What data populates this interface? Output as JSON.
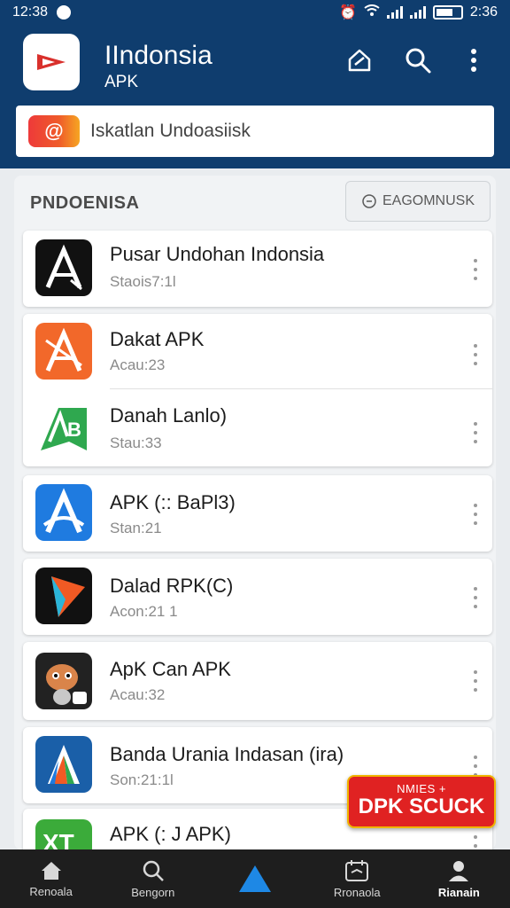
{
  "status_bar": {
    "time": "12:38",
    "clock": "2:36"
  },
  "header": {
    "title": "IIndonsia",
    "subtitle": "APK"
  },
  "search": {
    "placeholder": "Iskatlan Undoasiisk",
    "logo_text": "@"
  },
  "section": {
    "title": "PNDOENISA",
    "button_label": "EAGOMNUSK"
  },
  "apps": [
    {
      "name": "Pusar Undohan Indonsia",
      "meta": "Staois7:1l",
      "icon": "a-letter-black-icon"
    },
    {
      "name": "Dakat APK",
      "meta": "Acau:23",
      "icon": "a-letter-orange-icon"
    },
    {
      "name": "Danah Lanlo)",
      "meta": "Stau:33",
      "icon": "ab-green-icon"
    },
    {
      "name": "APK (:: BaPl3)",
      "meta": "Stan:21",
      "icon": "a-letter-blue-icon"
    },
    {
      "name": "Dalad RPK(C)",
      "meta": "Acon:21 1",
      "icon": "play-triangle-icon"
    },
    {
      "name": "ApK Can APK",
      "meta": "Acau:32",
      "icon": "creature-mascot-icon"
    },
    {
      "name": "Banda Urania Indasan (ira)",
      "meta": "Son:21:1l",
      "icon": "triangle-stripes-icon"
    },
    {
      "name": "APK (: J APK)",
      "meta": "",
      "icon": "xt-green-icon"
    }
  ],
  "promo": {
    "line1": "NMIES +",
    "line2": "DPK SCUCK"
  },
  "bottom_nav": [
    {
      "label": "Renoala",
      "icon": "home-icon"
    },
    {
      "label": "Bengorn",
      "icon": "search-icon"
    },
    {
      "label": "",
      "icon": "triangle-logo-icon"
    },
    {
      "label": "Rronaola",
      "icon": "calendar-icon"
    },
    {
      "label": "Rianain",
      "icon": "profile-icon"
    }
  ],
  "colors": {
    "header": "#0f3d6e",
    "accent_blue": "#1e88e5",
    "nav_bg": "#1e1e1e",
    "promo_red": "#e02222"
  }
}
